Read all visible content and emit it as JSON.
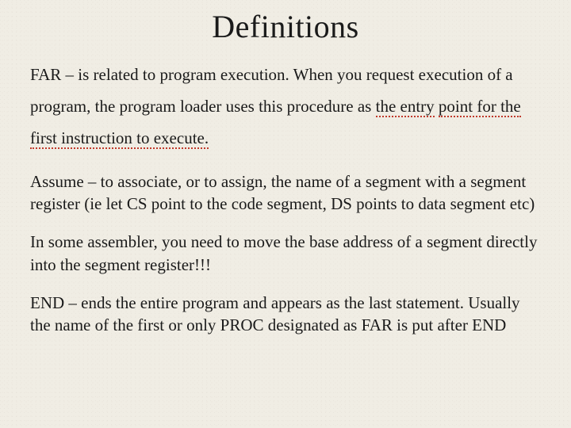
{
  "title": "Definitions",
  "p1": {
    "a": "FAR – is related to program execution. When you request execution of a program, the program loader uses this procedure as ",
    "err1": "the entry",
    "b": " ",
    "err2": "point for the first instruction to execute.",
    "c": ""
  },
  "p2": "Assume – to associate, or to assign, the name of a segment with a segment register (ie let CS point to the code segment, DS points to data segment etc)",
  "p3": "In some assembler, you need to move the base address of a segment directly into the segment register!!!",
  "p4": "END – ends the entire program and appears as the last statement. Usually the name of the first or only PROC designated as FAR is put after END"
}
